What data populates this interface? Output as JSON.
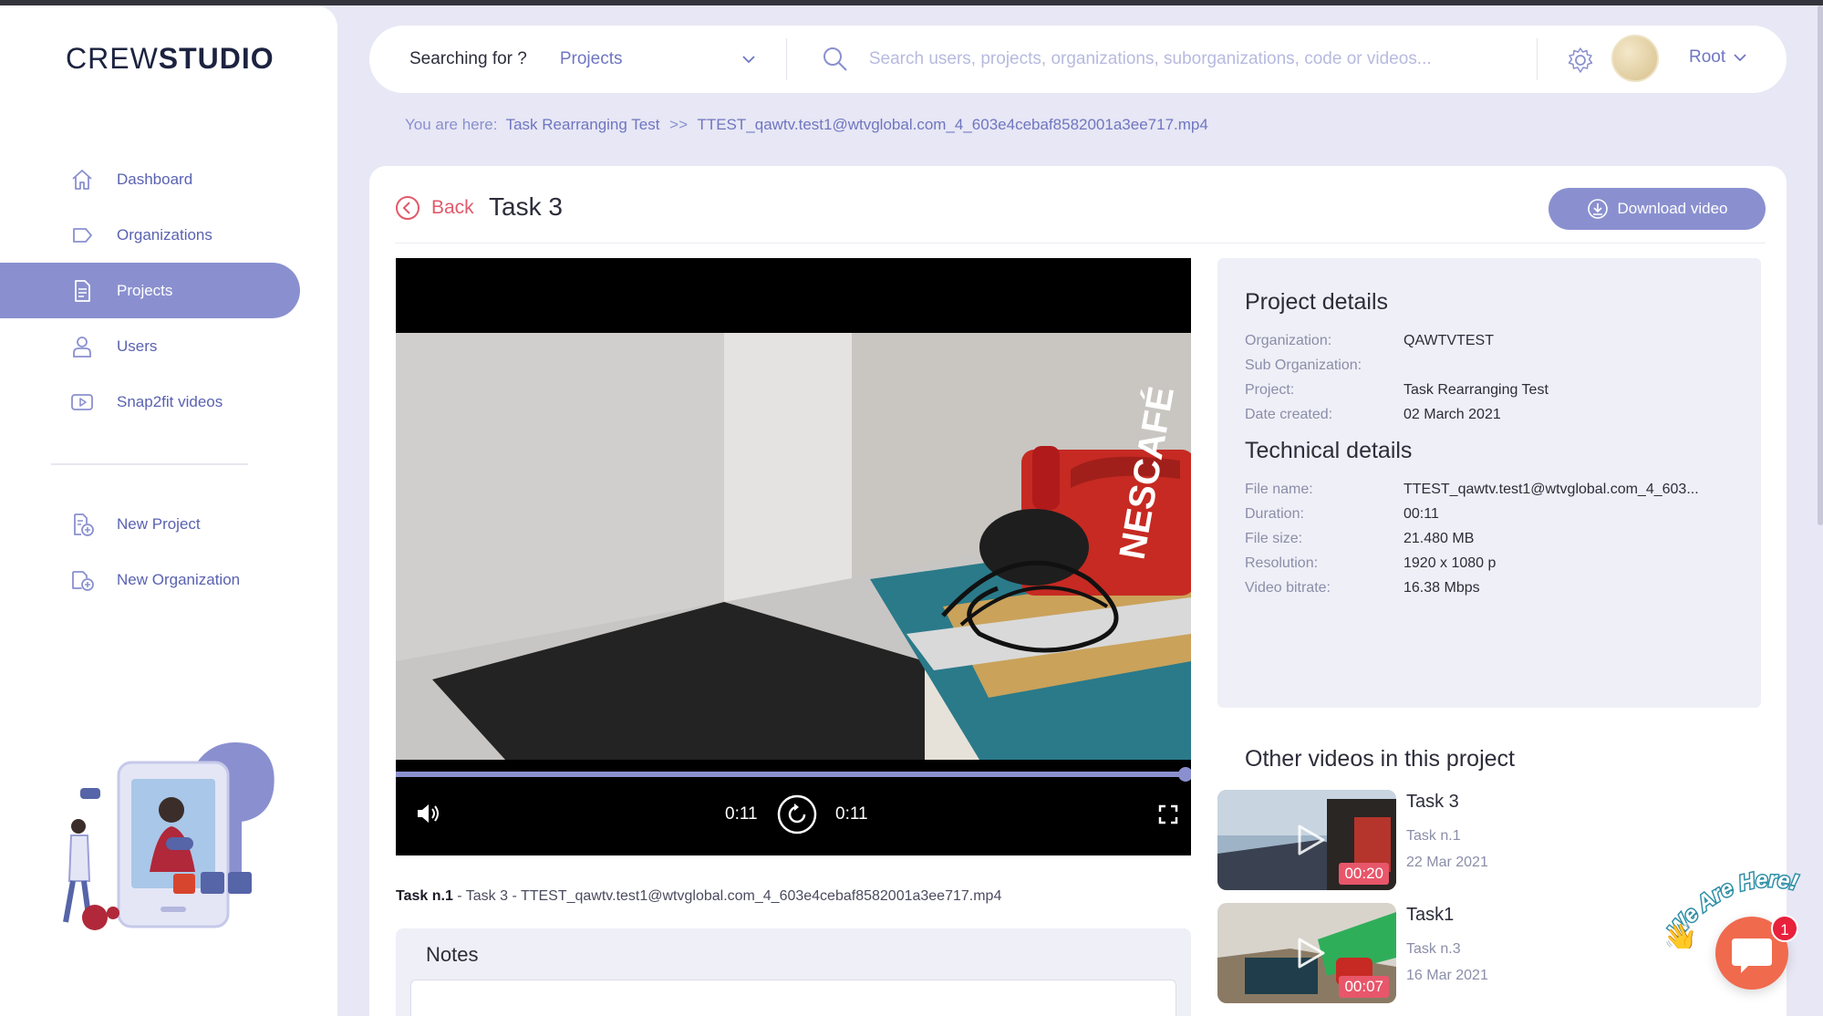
{
  "app": {
    "logo_light": "CREW",
    "logo_bold": "STUDIO",
    "colors": {
      "accent": "#8a90cf",
      "back": "#e05a6a",
      "badge": "#e8566a",
      "chat": "#f06a4e"
    }
  },
  "sidebar": {
    "items": [
      {
        "label": "Dashboard",
        "icon": "home-icon"
      },
      {
        "label": "Organizations",
        "icon": "tag-icon"
      },
      {
        "label": "Projects",
        "icon": "document-icon",
        "active": true
      },
      {
        "label": "Users",
        "icon": "user-icon"
      },
      {
        "label": "Snap2fit videos",
        "icon": "video-icon"
      }
    ],
    "actions": [
      {
        "label": "New Project",
        "icon": "new-project-icon"
      },
      {
        "label": "New Organization",
        "icon": "new-organization-icon"
      }
    ]
  },
  "search": {
    "prefix": "Searching for ?",
    "scope": "Projects",
    "placeholder": "Search users, projects, organizations, suborganizations, code or videos..."
  },
  "user": {
    "name": "Root"
  },
  "breadcrumb": {
    "label": "You are here:",
    "items": [
      "Task Rearranging Test",
      "TTEST_qawtv.test1@wtvglobal.com_4_603e4cebaf8582001a3ee717.mp4"
    ],
    "separator": ">>"
  },
  "page": {
    "back_label": "Back",
    "title": "Task 3",
    "download_label": "Download video"
  },
  "player": {
    "current_time": "0:11",
    "duration": "0:11",
    "progress": 1.0
  },
  "caption": {
    "task": "Task n.1",
    "rest": " - Task 3 - TTEST_qawtv.test1@wtvglobal.com_4_603e4cebaf8582001a3ee717.mp4"
  },
  "notes": {
    "title": "Notes"
  },
  "project_details": {
    "title": "Project details",
    "rows": [
      {
        "k": "Organization:",
        "v": "QAWTVTEST"
      },
      {
        "k": "Sub Organization:",
        "v": ""
      },
      {
        "k": "Project:",
        "v": "Task Rearranging Test"
      },
      {
        "k": "Date created:",
        "v": "02 March 2021"
      }
    ]
  },
  "technical_details": {
    "title": "Technical details",
    "rows": [
      {
        "k": "File name:",
        "v": "TTEST_qawtv.test1@wtvglobal.com_4_603..."
      },
      {
        "k": "Duration:",
        "v": "00:11"
      },
      {
        "k": "File size:",
        "v": "21.480 MB"
      },
      {
        "k": "Resolution:",
        "v": "1920 x 1080 p"
      },
      {
        "k": "Video bitrate:",
        "v": "16.38 Mbps"
      }
    ]
  },
  "other_videos": {
    "title": "Other videos in this project",
    "items": [
      {
        "name": "Task 3",
        "sub": "Task n.1",
        "date": "22 Mar 2021",
        "duration": "00:20"
      },
      {
        "name": "Task1",
        "sub": "Task n.3",
        "date": "16 Mar 2021",
        "duration": "00:07"
      }
    ]
  },
  "chat": {
    "label": "We Are Here!",
    "badge": "1"
  }
}
